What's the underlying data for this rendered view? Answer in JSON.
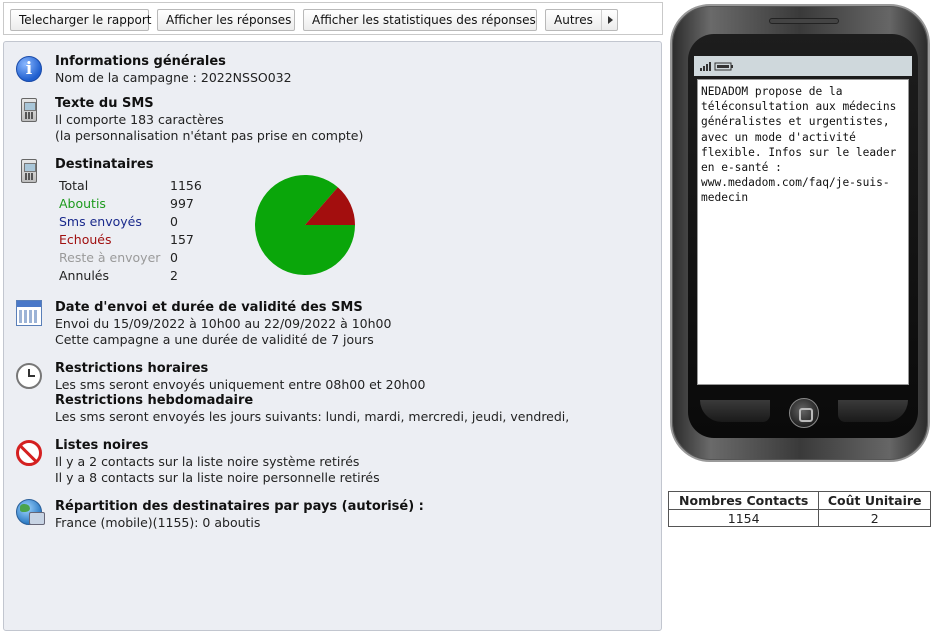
{
  "toolbar": {
    "download_report": "Telecharger le rapport",
    "show_responses": "Afficher les réponses",
    "show_stats": "Afficher les statistiques des réponses",
    "others": "Autres"
  },
  "general": {
    "title": "Informations générales",
    "campaign": "Nom de la campagne : 2022NSSO032"
  },
  "sms": {
    "title": "Texte du SMS",
    "line1": "Il comporte 183 caractères",
    "line2": "(la personnalisation n'étant pas prise en compte)"
  },
  "recipients": {
    "title": "Destinataires",
    "rows": [
      {
        "label": "Total",
        "value": "1156",
        "color": "#222222"
      },
      {
        "label": "Aboutis",
        "value": "997",
        "color": "#1c9a1c"
      },
      {
        "label": "Sms envoyés",
        "value": "0",
        "color": "#1a2a8c"
      },
      {
        "label": "Echoués",
        "value": "157",
        "color": "#a01010"
      },
      {
        "label": "Reste à envoyer",
        "value": "0",
        "color": "#9a9a9a"
      },
      {
        "label": "Annulés",
        "value": "2",
        "color": "#222222"
      }
    ]
  },
  "chart_data": {
    "type": "pie",
    "categories": [
      "Aboutis",
      "Echoués"
    ],
    "values": [
      997,
      157
    ],
    "colors": [
      "#0aa60a",
      "#a30e0e"
    ]
  },
  "dates": {
    "title": "Date d'envoi et durée de validité des SMS",
    "line1": "Envoi du 15/09/2022 à 10h00 au 22/09/2022 à 10h00",
    "line2": "Cette campagne a une durée de validité de 7 jours"
  },
  "hours": {
    "title": "Restrictions horaires",
    "line1": "Les sms seront envoyés uniquement entre 08h00 et 20h00",
    "title2": "Restrictions hebdomadaire",
    "line2": "Les sms seront envoyés les jours suivants: lundi, mardi, mercredi, jeudi, vendredi,"
  },
  "blacklist": {
    "title": "Listes noires",
    "line1": "Il y a 2 contacts sur la liste noire système retirés",
    "line2": "Il y a 8 contacts sur la liste noire personnelle retirés"
  },
  "countries": {
    "title": "Répartition des destinataires par pays (autorisé) :",
    "line1": "France (mobile)(1155): 0 aboutis"
  },
  "phone": {
    "message": "NEDADOM propose de la téléconsultation aux médecins généralistes et urgentistes, avec un mode d'activité flexible. Infos sur le leader en e-santé : www.medadom.com/faq/je-suis-medecin"
  },
  "cost_table": {
    "headers": [
      "Nombres Contacts",
      "Coût Unitaire"
    ],
    "row": [
      "1154",
      "2"
    ]
  }
}
